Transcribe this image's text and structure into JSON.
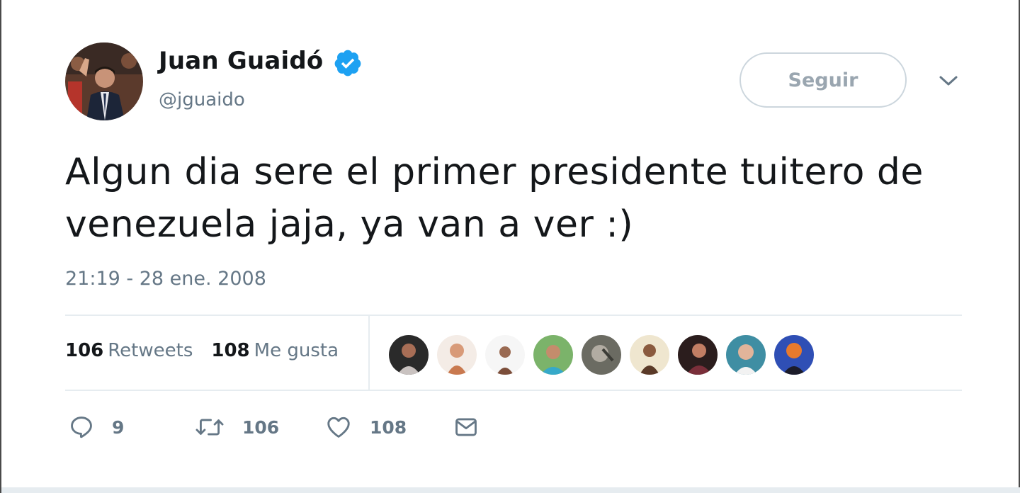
{
  "tweet": {
    "author_name": "Juan Guaidó",
    "handle": "@jguaido",
    "verified": true,
    "follow_label": "Seguir",
    "text": "Algun dia sere el primer presidente tuitero de venezuela jaja, ya van a ver :)",
    "timestamp": "21:19 - 28 ene. 2008",
    "stats": {
      "retweets_count": "106",
      "retweets_label": "Retweets",
      "likes_count": "108",
      "likes_label": "Me gusta"
    },
    "actions": {
      "reply_count": "9",
      "retweet_count": "106",
      "like_count": "108"
    },
    "liker_avatars": 9,
    "icons": {
      "verified": "verified-badge-icon",
      "more": "chevron-down-icon",
      "reply": "reply-icon",
      "retweet": "retweet-icon",
      "like": "heart-icon",
      "dm": "envelope-icon"
    },
    "colors": {
      "verified": "#1da1f2",
      "text": "#14171a",
      "secondary": "#657786",
      "border": "#e6ecf0",
      "follow_border": "#ccd6dd"
    }
  }
}
